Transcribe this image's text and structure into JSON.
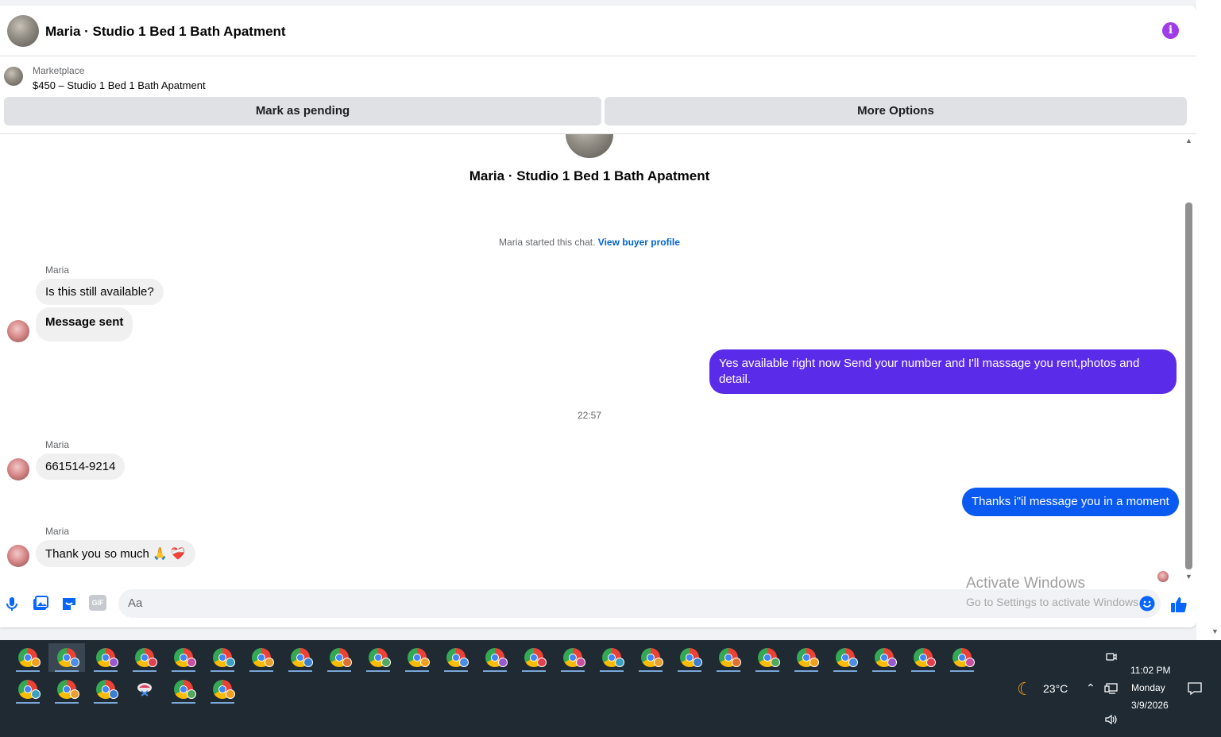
{
  "header": {
    "title": "Maria · Studio 1 Bed 1 Bath Apatment",
    "info_icon": "i"
  },
  "listing": {
    "category": "Marketplace",
    "item": "$450 – Studio 1 Bed 1 Bath Apatment",
    "mark_pending_label": "Mark as pending",
    "more_options_label": "More Options"
  },
  "conversation": {
    "title": "Maria · Studio 1 Bed 1 Bath Apatment",
    "system_text": "Maria started this chat.",
    "system_link": "View buyer profile",
    "messages": [
      {
        "sender": "Maria",
        "text": "Is this still available?"
      },
      {
        "text": "Message sent"
      },
      {
        "text": "Yes available right now Send your number and I'll massage you rent,photos and detail."
      },
      {
        "timestamp": "22:57"
      },
      {
        "sender": "Maria",
        "text": "661514-9214"
      },
      {
        "text": "Thanks i\"il message you in a moment"
      },
      {
        "sender": "Maria",
        "text": "Thank you so much 🙏 ❤️‍🩹"
      }
    ],
    "colors": {
      "outgoing_purple": "#5b2bea",
      "outgoing_blue": "#0a59f0",
      "incoming": "#f0f0f0"
    }
  },
  "composer": {
    "placeholder": "Aa",
    "icons": [
      "microphone-icon",
      "photo-icon",
      "sticker-icon",
      "gif-icon",
      "emoji-icon",
      "like-icon"
    ],
    "gif_label": "GIF"
  },
  "watermark": {
    "line1": "Activate Windows",
    "line2": "Go to Settings to activate Windows"
  },
  "taskbar": {
    "weather_temp": "23°C",
    "time": "11:02 PM",
    "day": "Monday",
    "date": "3/9/2026"
  }
}
